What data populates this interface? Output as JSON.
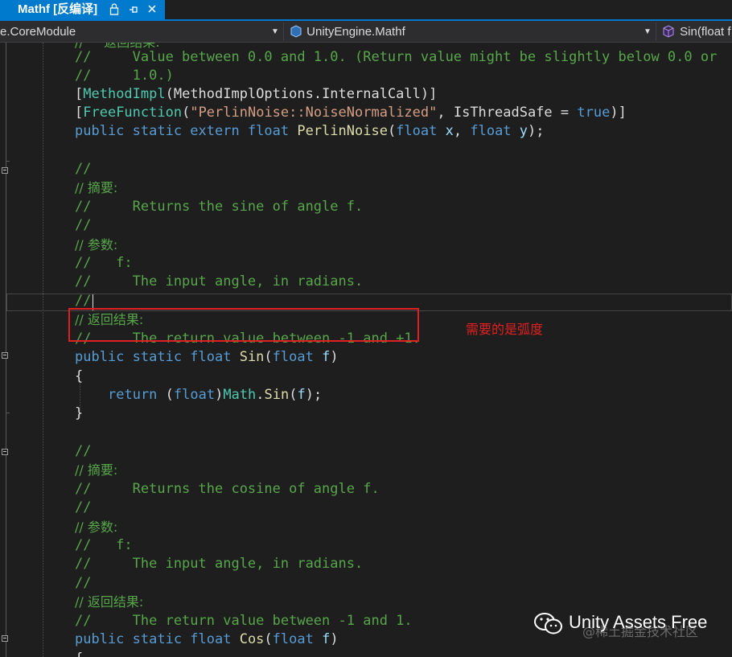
{
  "tab": {
    "title": "Mathf [反编译]",
    "lock_icon": "lock-icon",
    "pin_icon": "pin-icon",
    "close_icon": "close-icon"
  },
  "navbar": {
    "project": "e.CoreModule",
    "type": "UnityEngine.Mathf",
    "member": "Sin(float f"
  },
  "code": {
    "l0": "//     返回结果:",
    "l1_c": "//     Value between 0.0 and 1.0. (Return value might be slightly below 0.0 or",
    "l2_c": "//     1.0.)",
    "l3": {
      "a": "[",
      "b": "MethodImpl",
      "c": "(MethodImplOptions.InternalCall)]"
    },
    "l4": {
      "a": "[",
      "b": "FreeFunction",
      "c": "(",
      "d": "\"PerlinNoise::NoiseNormalized\"",
      "e": ", IsThreadSafe = ",
      "f": "true",
      "g": ")]"
    },
    "l5": {
      "a": "public static extern float ",
      "b": "PerlinNoise",
      "c": "(",
      "d": "float",
      "e": " ",
      "f": "x",
      "g": ", ",
      "h": "float",
      "i": " ",
      "j": "y",
      "k": ");"
    },
    "l7_c": "//",
    "l8_c": "// 摘要:",
    "l9_c": "//     Returns the sine of angle f.",
    "l10_c": "//",
    "l11_c": "// 参数:",
    "l12_c": "//   f:",
    "l13_c": "//     The input angle, in radians.",
    "l14_c": "//",
    "l15_c": "// 返回结果:",
    "l16_c": "//     The return value between -1 and +1.",
    "l17": {
      "a": "public static float ",
      "b": "Sin",
      "c": "(",
      "d": "float",
      "e": " ",
      "f": "f",
      "g": ")"
    },
    "l18": "{",
    "l19": {
      "a": "return ",
      "b": "(",
      "c": "float",
      "d": ")",
      "e": "Math",
      "f": ".",
      "g": "Sin",
      "h": "(",
      "i": "f",
      "j": ");"
    },
    "l20": "}",
    "l22_c": "//",
    "l23_c": "// 摘要:",
    "l24_c": "//     Returns the cosine of angle f.",
    "l25_c": "//",
    "l26_c": "// 参数:",
    "l27_c": "//   f:",
    "l28_c": "//     The input angle, in radians.",
    "l29_c": "//",
    "l30_c": "// 返回结果:",
    "l31_c": "//     The return value between -1 and 1.",
    "l32": {
      "a": "public static float ",
      "b": "Cos",
      "c": "(",
      "d": "float",
      "e": " ",
      "f": "f",
      "g": ")"
    },
    "l33": "{"
  },
  "annotation": {
    "text": "需要的是弧度",
    "color": "#e02020"
  },
  "watermark": {
    "name": "Unity Assets Free",
    "site": "@稀土掘金技术社区",
    "logo_icon": "wechat-icon"
  },
  "colors": {
    "comment": "#57a64a",
    "keyword": "#569cd6",
    "type": "#4ec9b0",
    "string": "#d69d85",
    "method": "#dcdcaa",
    "param": "#9cdcfe",
    "accent": "#007acc"
  }
}
